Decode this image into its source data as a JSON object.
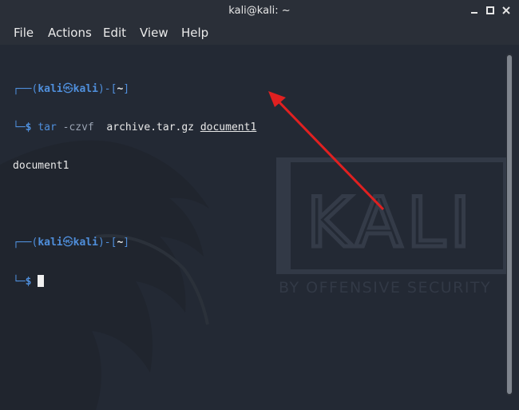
{
  "window": {
    "title": "kali@kali: ~"
  },
  "menu": {
    "file": "File",
    "actions": "Actions",
    "edit": "Edit",
    "view": "View",
    "help": "Help"
  },
  "terminal": {
    "prompt_open": "┌──(",
    "user": "kali",
    "at_icon": "㉿",
    "host": "kali",
    "prompt_mid": ")-[",
    "dir": "~",
    "prompt_close": "]",
    "prompt_line2": "└─",
    "dollar": "$",
    "command": "tar",
    "args": "-czvf",
    "archive": "archive.tar.gz",
    "file": "document1",
    "output": "document1"
  },
  "background": {
    "brand": "KALI",
    "tagline": "BY OFFENSIVE SECURITY"
  },
  "colors": {
    "accent_blue": "#4f8fdc",
    "arrow": "#e02020"
  }
}
